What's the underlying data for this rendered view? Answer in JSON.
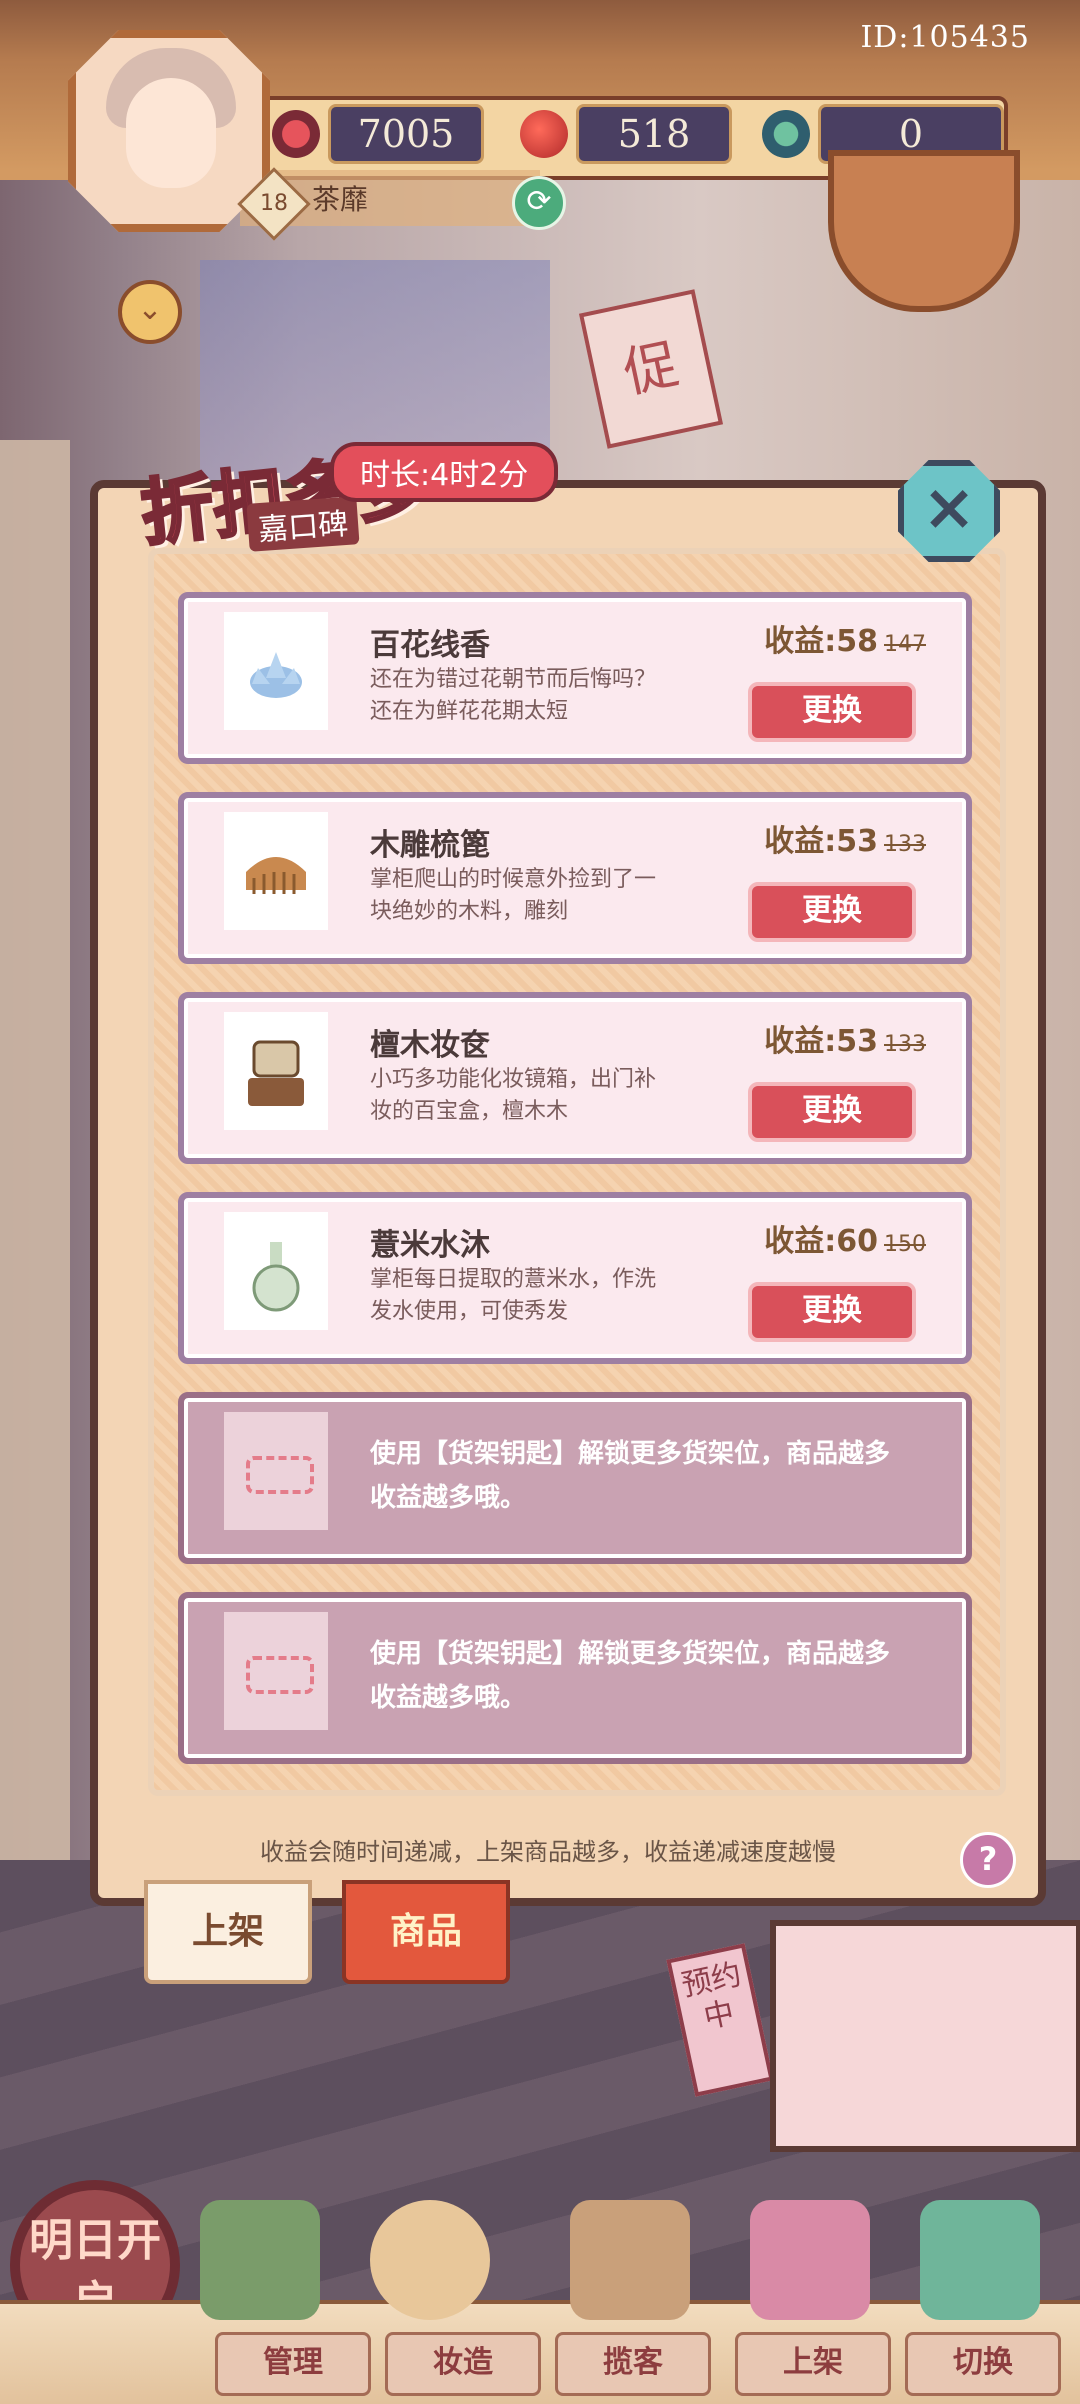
{
  "header": {
    "user_id": "ID:105435",
    "level": "18",
    "username": "茶靡",
    "resources": [
      {
        "icon": "heart-icon",
        "value": "7005"
      },
      {
        "icon": "apple-icon",
        "value": "518"
      },
      {
        "icon": "jade-icon",
        "value": "0"
      }
    ]
  },
  "panel": {
    "title": "折扣多多",
    "subtitle": "嘉口碑",
    "timer": "时长:4时2分",
    "items": [
      {
        "name": "百花线香",
        "desc": "还在为错过花朝节而后悔吗？还在为鲜花花期太短",
        "income": "收益:58",
        "old": "147",
        "swap": "更换"
      },
      {
        "name": "木雕梳篦",
        "desc": "掌柜爬山的时候意外捡到了一块绝妙的木料，雕刻",
        "income": "收益:53",
        "old": "133",
        "swap": "更换"
      },
      {
        "name": "檀木妆奁",
        "desc": "小巧多功能化妆镜箱，出门补妆的百宝盒，檀木木",
        "income": "收益:53",
        "old": "133",
        "swap": "更换"
      },
      {
        "name": "薏米水沐",
        "desc": "掌柜每日提取的薏米水，作洗发水使用，可使秀发",
        "income": "收益:60",
        "old": "150",
        "swap": "更换"
      }
    ],
    "locked_slots": [
      {
        "text": "使用【货架钥匙】解锁更多货架位，商品越多收益越多哦。"
      },
      {
        "text": "使用【货架钥匙】解锁更多货架位，商品越多收益越多哦。"
      }
    ],
    "tip": "收益会随时间递减，上架商品越多，收益递减速度越慢",
    "help": "?"
  },
  "tabs": {
    "listed": "上架",
    "goods": "商品"
  },
  "scene": {
    "reserve_sign": "预约中",
    "promo_sign": "促",
    "open_badge": "明日开启"
  },
  "bottom_nav": [
    {
      "label": "管理"
    },
    {
      "label": "妆造"
    },
    {
      "label": "揽客"
    },
    {
      "label": "上架"
    },
    {
      "label": "切换"
    }
  ]
}
